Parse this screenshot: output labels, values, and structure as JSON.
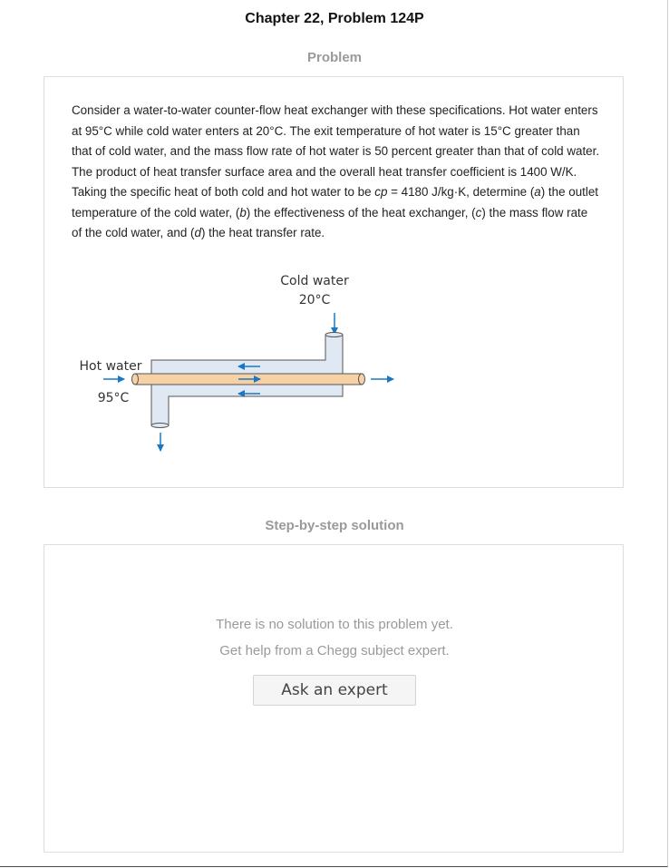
{
  "header": {
    "title": "Chapter 22, Problem 124P"
  },
  "problem": {
    "section_label": "Problem",
    "text_segments": [
      "Consider a water-to-water counter-flow heat exchanger with these specifications. Hot water enters at 95°C while cold water enters at 20°C. The exit temperature of hot water is 15°C greater than that of cold water, and the mass flow rate of hot water is 50 percent greater than that of cold water. The product of heat transfer surface area and the overall heat transfer coefficient is 1400 W/K. Taking the specific heat of both cold and hot water to be ",
      "cp",
      " = 4180 J/kg·K, determine (",
      "a",
      ") the outlet temperature of the cold water, (",
      "b",
      ") the effectiveness of the heat exchanger, (",
      "c",
      ") the mass flow rate of the cold water, and (",
      "d",
      ") the heat transfer rate."
    ],
    "diagram": {
      "cold_label": "Cold water",
      "cold_temp": "20°C",
      "hot_label": "Hot water",
      "hot_temp": "95°C"
    },
    "colors": {
      "arrow": "#1a78c2",
      "hot_tube_fill": "#f7d1a6",
      "shell_fill": "#dfe8f3",
      "outline": "#555555"
    }
  },
  "solution": {
    "section_label": "Step-by-step solution",
    "empty_line1": "There is no solution to this problem yet.",
    "empty_line2": "Get help from a Chegg subject expert.",
    "ask_button_label": "Ask an expert"
  }
}
